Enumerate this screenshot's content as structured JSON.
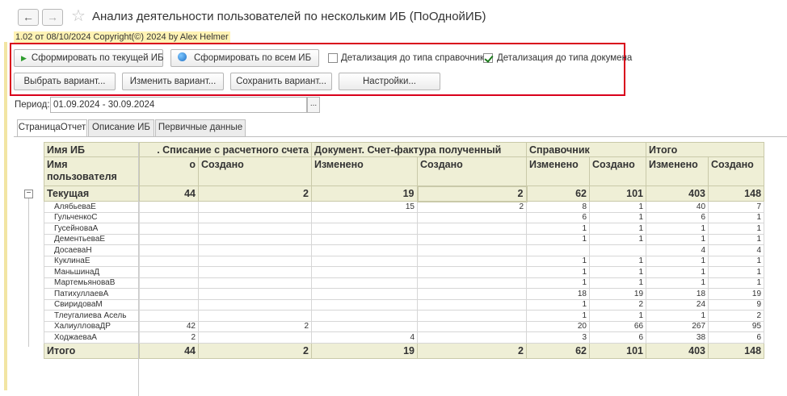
{
  "header": {
    "title": "Анализ деятельности пользователей по нескольким ИБ (ПоОднойИБ)",
    "version": "1.02 от 08/10/2024 Copyright(©) 2024 by Alex Helmer",
    "back": "←",
    "forward": "→",
    "star": "☆"
  },
  "toolbar": {
    "run_current": "Сформировать по текущей ИБ",
    "run_all": "Сформировать по всем ИБ",
    "detail_catalog": "Детализация до типа справочника",
    "detail_catalog_checked": false,
    "detail_document": "Детализация до типа докумена",
    "detail_document_checked": true,
    "select_variant": "Выбрать вариант...",
    "change_variant": "Изменить вариант...",
    "save_variant": "Сохранить вариант...",
    "settings": "Настройки..."
  },
  "period": {
    "label": "Период:",
    "value": "01.09.2024 - 30.09.2024",
    "button": "..."
  },
  "tabs": [
    "СтраницаОтчет",
    "Описание ИБ",
    "Первичные данные"
  ],
  "report": {
    "col_header1": [
      "Имя ИБ",
      ". Списание с расчетного счета",
      "Документ. Счет-фактура полученный",
      "Справочник",
      "Итого"
    ],
    "col_header2": [
      "Имя пользователя",
      "о",
      "Создано",
      "Изменено",
      "Создано",
      "Изменено",
      "Создано",
      "Изменено",
      "Создано"
    ],
    "group": {
      "name": "Текущая",
      "values": [
        "44",
        "2",
        "19",
        "2",
        "62",
        "101",
        "403",
        "148"
      ]
    },
    "rows": [
      {
        "name": "АлябьеваЕ",
        "values": [
          "",
          "",
          "15",
          "2",
          "8",
          "1",
          "40",
          "7"
        ]
      },
      {
        "name": "ГульченкоС",
        "values": [
          "",
          "",
          "",
          "",
          "6",
          "1",
          "6",
          "1"
        ]
      },
      {
        "name": "ГусейноваА",
        "values": [
          "",
          "",
          "",
          "",
          "1",
          "1",
          "1",
          "1"
        ]
      },
      {
        "name": "ДементьеваЕ",
        "values": [
          "",
          "",
          "",
          "",
          "1",
          "1",
          "1",
          "1"
        ]
      },
      {
        "name": "ДосаеваН",
        "values": [
          "",
          "",
          "",
          "",
          "",
          "",
          "4",
          "4"
        ]
      },
      {
        "name": "КуклинаЕ",
        "values": [
          "",
          "",
          "",
          "",
          "1",
          "1",
          "1",
          "1"
        ]
      },
      {
        "name": "МаньшинаД",
        "values": [
          "",
          "",
          "",
          "",
          "1",
          "1",
          "1",
          "1"
        ]
      },
      {
        "name": "МартемьяноваВ",
        "values": [
          "",
          "",
          "",
          "",
          "1",
          "1",
          "1",
          "1"
        ]
      },
      {
        "name": "ПатихуллаевА",
        "values": [
          "",
          "",
          "",
          "",
          "18",
          "19",
          "18",
          "19"
        ]
      },
      {
        "name": "СвиридоваМ",
        "values": [
          "",
          "",
          "",
          "",
          "1",
          "2",
          "24",
          "9"
        ]
      },
      {
        "name": "Тлеугалиева Асель",
        "values": [
          "",
          "",
          "",
          "",
          "1",
          "1",
          "1",
          "2"
        ]
      },
      {
        "name": "ХалиулловаДР",
        "values": [
          "42",
          "2",
          "",
          "",
          "20",
          "66",
          "267",
          "95"
        ]
      },
      {
        "name": "ХоджаеваА",
        "values": [
          "2",
          "",
          "4",
          "",
          "3",
          "6",
          "38",
          "6"
        ]
      }
    ],
    "total": {
      "name": "Итого",
      "values": [
        "44",
        "2",
        "19",
        "2",
        "62",
        "101",
        "403",
        "148"
      ]
    }
  }
}
